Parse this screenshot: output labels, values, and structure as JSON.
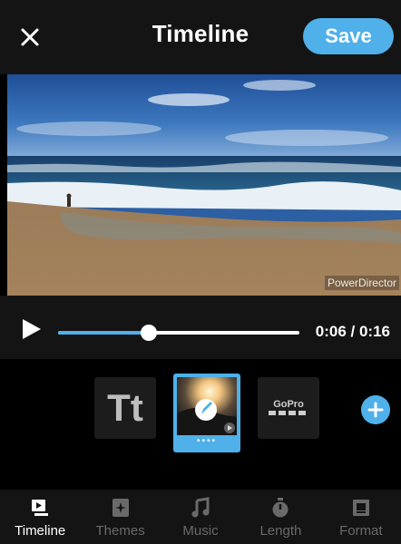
{
  "header": {
    "title": "Timeline",
    "save_label": "Save"
  },
  "preview": {
    "watermark": "PowerDirector"
  },
  "playback": {
    "time_display": "0:06 / 0:16",
    "progress": 0.375
  },
  "clips": {
    "title_clip_label": "Tt",
    "selected_dots": "••••"
  },
  "nav": {
    "items": [
      {
        "label": "Timeline",
        "icon": "timeline-icon",
        "active": true
      },
      {
        "label": "Themes",
        "icon": "themes-icon",
        "active": false
      },
      {
        "label": "Music",
        "icon": "music-note-icon",
        "active": false
      },
      {
        "label": "Length",
        "icon": "stopwatch-icon",
        "active": false
      },
      {
        "label": "Format",
        "icon": "format-icon",
        "active": false
      }
    ]
  },
  "colors": {
    "accent": "#4fb0ea",
    "header_bg": "#141414",
    "inactive_label": "#6a6a6a"
  }
}
